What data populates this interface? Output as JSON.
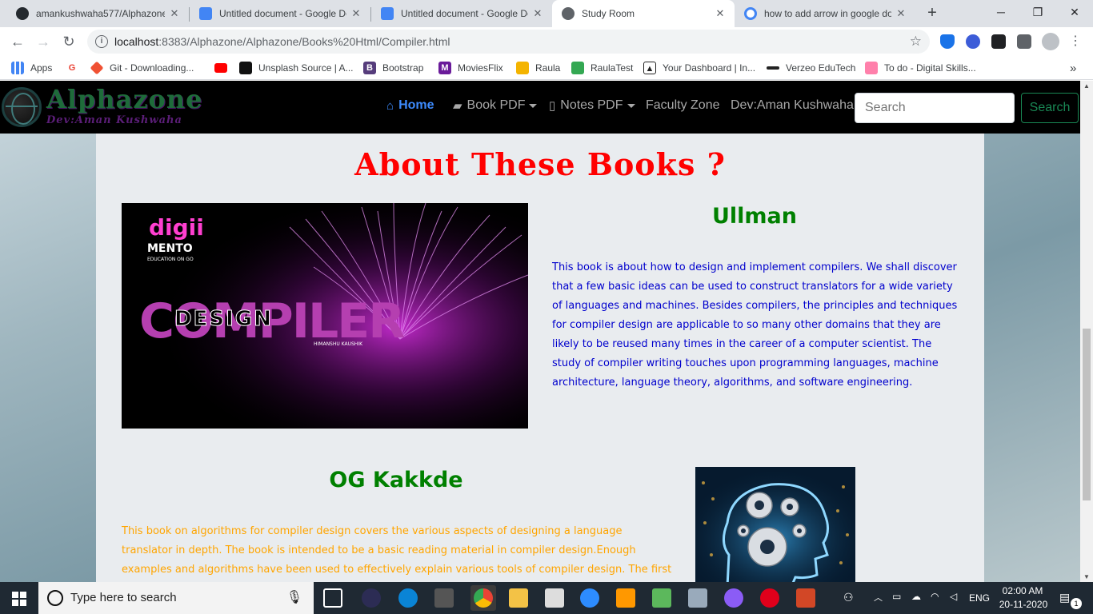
{
  "browser": {
    "tabs": [
      {
        "title": "amankushwaha577/Alphazone",
        "close": "✕",
        "icon": "github-icon"
      },
      {
        "title": "Untitled document - Google Do",
        "close": "✕",
        "icon": "google-docs-icon"
      },
      {
        "title": "Untitled document - Google Do",
        "close": "✕",
        "icon": "google-docs-icon"
      },
      {
        "title": "Study Room",
        "close": "✕",
        "icon": "globe-icon"
      },
      {
        "title": "how to add arrow in google do",
        "close": "✕",
        "icon": "google-icon"
      }
    ],
    "new_tab": "+",
    "window_controls": {
      "minimize": "─",
      "maximize": "❐",
      "close": "✕"
    },
    "nav": {
      "back": "←",
      "forward": "→",
      "reload": "↻"
    },
    "url_host": "localhost",
    "url_rest": ":8383/Alphazone/Alphazone/Books%20Html/Compiler.html",
    "star": "☆",
    "bookmarks": [
      {
        "label": "Apps",
        "icon": "apps-grid-icon"
      },
      {
        "label": "",
        "icon": "google-icon"
      },
      {
        "label": "Git - Downloading...",
        "icon": "git-icon"
      },
      {
        "label": "",
        "icon": "youtube-icon"
      },
      {
        "label": "Unsplash Source | A...",
        "icon": "unsplash-icon"
      },
      {
        "label": "Bootstrap",
        "icon": "bootstrap-icon"
      },
      {
        "label": "MoviesFlix",
        "icon": "moviesflix-icon"
      },
      {
        "label": "Raula",
        "icon": "raula-icon"
      },
      {
        "label": "RaulaTest",
        "icon": "raulatest-icon"
      },
      {
        "label": "Your Dashboard | In...",
        "icon": "dashboard-icon"
      },
      {
        "label": "Verzeo EduTech",
        "icon": "verzeo-icon"
      },
      {
        "label": "To do - Digital Skills...",
        "icon": "todo-icon"
      }
    ],
    "bookmarks_more": "»"
  },
  "site": {
    "logo_text": "Alphazone",
    "logo_sub": "Dev:Aman Kushwaha",
    "nav": {
      "home": "Home",
      "book_pdf": "Book PDF",
      "notes_pdf": "Notes PDF",
      "faculty": "Faculty Zone",
      "dev": "Dev:Aman Kushwaha"
    },
    "search_placeholder": "Search",
    "search_button": "Search"
  },
  "content": {
    "title": "About These Books ?",
    "book1": {
      "heading": "Ullman",
      "description": "This book is about how to design and implement compilers. We shall discover that a few basic ideas can be used to construct translators for a wide variety of languages and machines. Besides compilers, the principles and techniques for compiler design are applicable to so many other domains that they are likely to be reused many times in the career of a computer scientist. The study of compiler writing touches upon programming languages, machine architecture, language theory, algorithms, and software engineering.",
      "cover": {
        "brand_top": "digii",
        "brand_mid": "MENTO",
        "brand_tag": "EDUCATION ON GO",
        "word_big": "COMPILER",
        "word_overlay": "DESIGN",
        "author": "HIMANSHU KAUSHIK"
      }
    },
    "book2": {
      "heading": "OG Kakkde",
      "description": "This book on algorithms for compiler design covers the various aspects of designing a language translator in depth. The book is intended to be a basic reading material in compiler design.Enough examples and algorithms have been used to effectively explain various tools of compiler design. The first chapter gives a brief introduction of the compiler"
    }
  },
  "taskbar": {
    "search_placeholder": "Type here to search",
    "language": "ENG",
    "time": "02:00 AM",
    "date": "20-11-2020",
    "notifications": "1"
  }
}
